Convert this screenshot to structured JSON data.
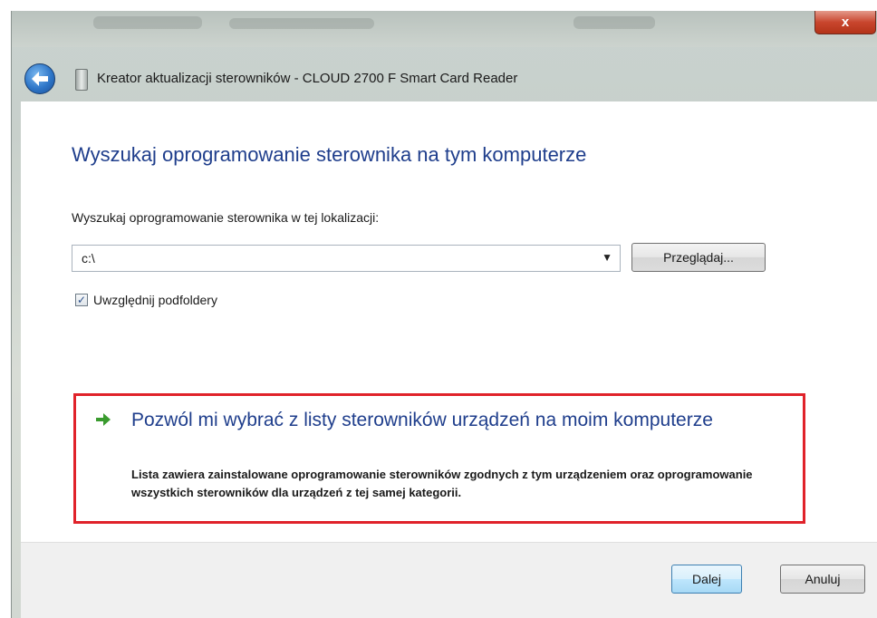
{
  "window": {
    "title": "Kreator aktualizacji sterowników - CLOUD 2700 F Smart Card Reader",
    "close_label": "x"
  },
  "main": {
    "heading": "Wyszukaj oprogramowanie sterownika na tym komputerze",
    "location_label": "Wyszukaj oprogramowanie sterownika w tej lokalizacji:",
    "location_value": "c:\\",
    "browse_label": "Przeglądaj...",
    "include_subfolders_label": "Uwzględnij podfoldery",
    "include_subfolders_checked": true,
    "option_title": "Pozwól mi wybrać z listy sterowników urządzeń na moim komputerze",
    "option_description": "Lista zawiera zainstalowane oprogramowanie sterowników zgodnych z tym urządzeniem oraz oprogramowanie wszystkich sterowników dla urządzeń z tej samej kategorii."
  },
  "footer": {
    "next_label": "Dalej",
    "cancel_label": "Anuluj"
  },
  "colors": {
    "heading": "#1f3e8c",
    "highlight_border": "#e0222a",
    "close_button": "#c9462e",
    "arrow_green": "#3a9b2e"
  }
}
